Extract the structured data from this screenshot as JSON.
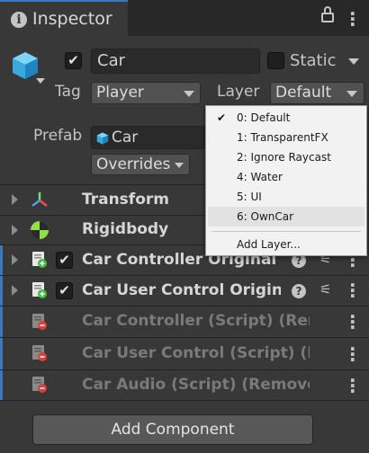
{
  "window": {
    "tab_title": "Inspector",
    "tab_icon": "info-icon"
  },
  "gameobject": {
    "active": true,
    "name": "Car",
    "static_label": "Static",
    "tag_label": "Tag",
    "tag_value": "Player",
    "layer_label": "Layer",
    "layer_value": "Default",
    "prefab_label": "Prefab",
    "prefab_name": "Car",
    "overrides_label": "Overrides"
  },
  "components": [
    {
      "name": "Transform",
      "icon": "transform-icon",
      "enabled_toggle": false,
      "state": "normal"
    },
    {
      "name": "Rigidbody",
      "icon": "rigidbody-icon",
      "enabled_toggle": false,
      "state": "normal"
    },
    {
      "name": "Car Controller Original (S",
      "icon": "script-added-icon",
      "enabled_toggle": true,
      "checked": true,
      "state": "added"
    },
    {
      "name": "Car User Control Origina",
      "icon": "script-added-icon",
      "enabled_toggle": true,
      "checked": true,
      "state": "added"
    },
    {
      "name": "Car Controller (Script) (Rem",
      "icon": "script-removed-icon",
      "enabled_toggle": false,
      "state": "removed"
    },
    {
      "name": "Car User Control (Script) (R",
      "icon": "script-removed-icon",
      "enabled_toggle": false,
      "state": "removed"
    },
    {
      "name": "Car Audio (Script) (Remove",
      "icon": "script-removed-icon",
      "enabled_toggle": false,
      "state": "removed"
    }
  ],
  "add_component_label": "Add Component",
  "layer_menu": {
    "items": [
      {
        "label": "0: Default",
        "checked": true
      },
      {
        "label": "1: TransparentFX",
        "checked": false
      },
      {
        "label": "2: Ignore Raycast",
        "checked": false
      },
      {
        "label": "4: Water",
        "checked": false
      },
      {
        "label": "5: UI",
        "checked": false
      },
      {
        "label": "6: OwnCar",
        "checked": false,
        "highlighted": true
      }
    ],
    "add_layer_label": "Add Layer..."
  },
  "colors": {
    "background": "#383838",
    "accent": "#3a79bb",
    "added_badge": "#3fbf3f",
    "removed_badge": "#d9413a"
  }
}
